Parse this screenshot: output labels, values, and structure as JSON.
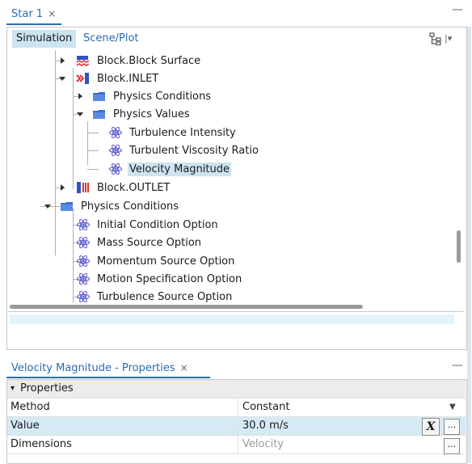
{
  "top_panel": {
    "tab_title": "Star 1",
    "close_glyph": "×",
    "minimize_glyph": "—",
    "tabs": [
      "Simulation",
      "Scene/Plot"
    ],
    "menu_glyph": "|▾"
  },
  "tree": [
    {
      "label": "Block.Block Surface",
      "icon": "block-surface-icon"
    },
    {
      "label": "Block.INLET",
      "icon": "block-inlet-icon"
    },
    {
      "label": "Physics Conditions",
      "icon": "folder-icon"
    },
    {
      "label": "Physics Values",
      "icon": "folder-icon"
    },
    {
      "label": "Turbulence Intensity",
      "icon": "physics-value-icon"
    },
    {
      "label": "Turbulent Viscosity Ratio",
      "icon": "physics-value-icon"
    },
    {
      "label": "Velocity Magnitude",
      "icon": "physics-value-icon",
      "selected": true
    },
    {
      "label": "Block.OUTLET",
      "icon": "block-outlet-icon"
    },
    {
      "label": "Physics Conditions",
      "icon": "folder-icon"
    },
    {
      "label": "Initial Condition Option",
      "icon": "physics-value-icon"
    },
    {
      "label": "Mass Source Option",
      "icon": "physics-value-icon"
    },
    {
      "label": "Momentum Source Option",
      "icon": "physics-value-icon"
    },
    {
      "label": "Motion Specification Option",
      "icon": "physics-value-icon"
    },
    {
      "label": "Turbulence Source Option",
      "icon": "physics-value-icon"
    }
  ],
  "properties_panel": {
    "tab_title": "Velocity Magnitude - Properties",
    "close_glyph": "×",
    "minimize_glyph": "—",
    "section_label": "Properties",
    "section_arrow": "▾",
    "rows": [
      {
        "key": "Method",
        "value": "Constant"
      },
      {
        "key": "Value",
        "value": "30.0 m/s"
      },
      {
        "key": "Dimensions",
        "value": "Velocity"
      }
    ],
    "dropdown_glyph": "▼",
    "function_button_label": "X",
    "ellipsis_label": "..."
  }
}
